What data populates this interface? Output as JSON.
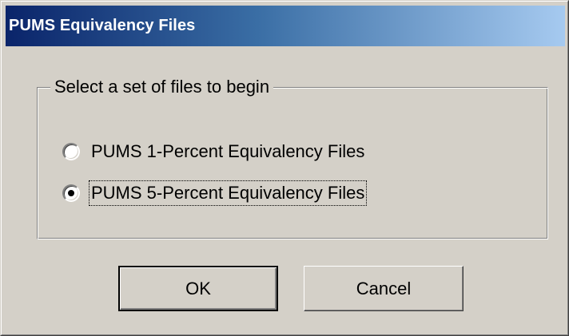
{
  "window": {
    "title": "PUMS Equivalency Files"
  },
  "group": {
    "legend": "Select a set of files to begin",
    "options": [
      {
        "label": "PUMS 1-Percent Equivalency Files",
        "selected": false
      },
      {
        "label": "PUMS 5-Percent Equivalency Files",
        "selected": true
      }
    ]
  },
  "buttons": {
    "ok_label": "OK",
    "cancel_label": "Cancel"
  },
  "colors": {
    "dialog_face": "#d4d0c8",
    "titlebar_start": "#0a246a",
    "titlebar_end": "#a6caf0"
  }
}
